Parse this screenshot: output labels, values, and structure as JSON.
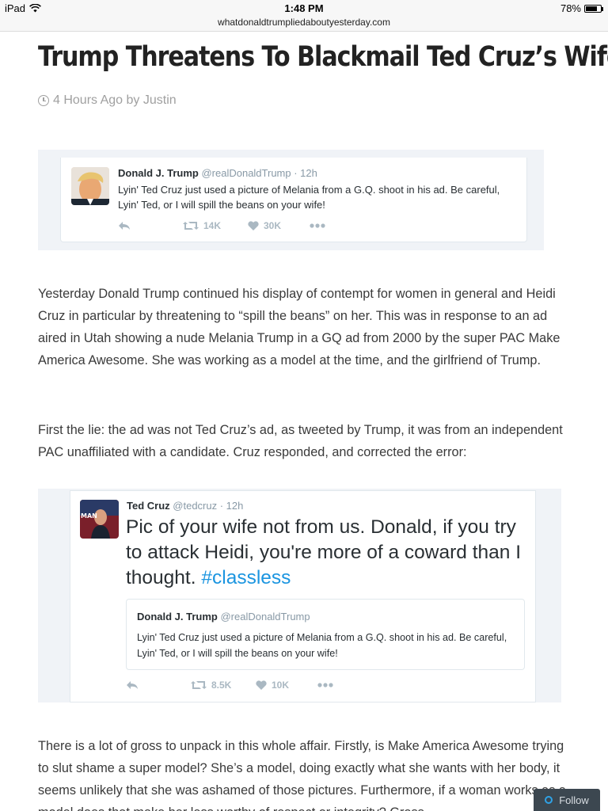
{
  "status_bar": {
    "device": "iPad",
    "time": "1:48 PM",
    "battery_text": "78%",
    "battery_level": 0.78
  },
  "url": "whatdonaldtrumpliedaboutyesterday.com",
  "article": {
    "title": "Trump Threatens To Blackmail Ted Cruz’s Wife",
    "meta": "4 Hours Ago by Justin",
    "paragraph1": "Yesterday Donald Trump continued his display of contempt for women in general and Heidi Cruz in particular by threatening to “spill the beans” on her. This was in response to an ad aired in Utah showing a nude Melania Trump in a GQ ad from 2000 by the super PAC Make America Awesome. She was working as a model at the time, and the girlfriend of Trump.",
    "paragraph2": "First the lie: the ad was not Ted Cruz’s ad, as tweeted by Trump, it was from an independent PAC unaffiliated with a candidate. Cruz responded, and corrected the error:",
    "paragraph3": "There is a lot of gross to unpack in this whole affair. Firstly, is Make America Awesome trying to slut shame a super model? She’s a model, doing exactly what she wants with her body, it seems unlikely that she was ashamed of those pictures. Furthermore, if a woman works as a model does that make her less worthy of respect or integrity? Gross."
  },
  "tweet1": {
    "name": "Donald J. Trump",
    "handle": "@realDonaldTrump · 12h",
    "text": "Lyin' Ted Cruz just used a picture of Melania from a G.Q. shoot in his ad. Be careful, Lyin' Ted, or I will spill the beans on your wife!",
    "retweets": "14K",
    "likes": "30K"
  },
  "tweet2": {
    "name": "Ted Cruz",
    "handle": "@tedcruz · 12h",
    "text": "Pic of your wife not from us. Donald, if you try to attack Heidi, you're more of a coward than I thought.",
    "hashtag": "#classless",
    "retweets": "8.5K",
    "likes": "10K",
    "quoted": {
      "name": "Donald J. Trump",
      "handle": "@realDonaldTrump",
      "text": "Lyin' Ted Cruz just used a picture of Melania from a G.Q. shoot in his ad. Be careful, Lyin' Ted, or I will spill the beans on your wife!"
    }
  },
  "follow_button": {
    "label": "Follow"
  },
  "colors": {
    "link_blue": "#1b95e0",
    "muted_text": "#a0a0a0",
    "follow_bg": "#3c4750"
  }
}
